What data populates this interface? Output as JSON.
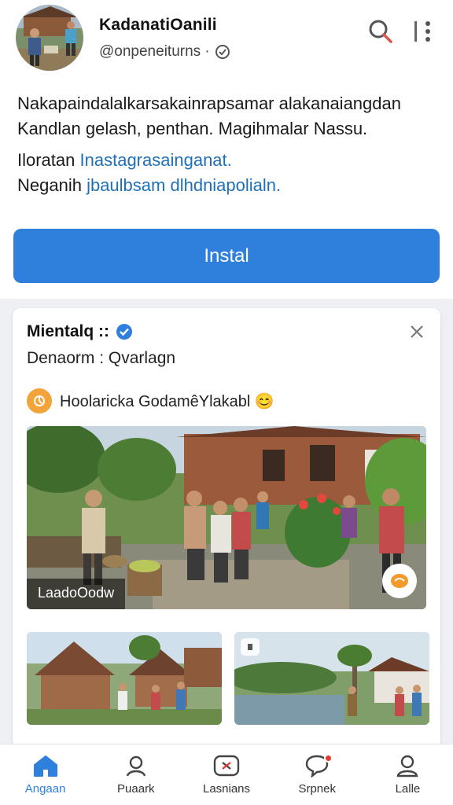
{
  "profile": {
    "name": "KadanatiOanili",
    "handle": "@onpeneiturns ·",
    "bio_line1": "Nakapaindalalkarsakainrapsamar alakanaiangdan",
    "bio_line2": "Kandlan gelash, penthan. Magihmalar Nassu.",
    "link_line1_prefix": "Iloratan",
    "link_line1_link": "Inastagrasainganat.",
    "link_line2_prefix": "Neganih",
    "link_line2_link": "jbaulbsam dlhdniapolialn.",
    "install_label": "Instal"
  },
  "post": {
    "title": "Mientalq ::",
    "subtitle": "Denaorm : Qvarlagn",
    "chip_text": "Hoolaricka GodamêYlakabl 😊",
    "photo_label": "LaadoOodw"
  },
  "nav": {
    "items": [
      {
        "label": "Angaan",
        "icon": "home-icon"
      },
      {
        "label": "Puaark",
        "icon": "search-person-icon"
      },
      {
        "label": "Lasnians",
        "icon": "games-icon"
      },
      {
        "label": "Srpnek",
        "icon": "chat-notification-icon"
      },
      {
        "label": "Lalle",
        "icon": "profile-icon"
      }
    ]
  },
  "colors": {
    "accent": "#2f7fdc",
    "link": "#1f6fb8",
    "feed_bg": "#eef0f3",
    "notification": "#e53935"
  }
}
